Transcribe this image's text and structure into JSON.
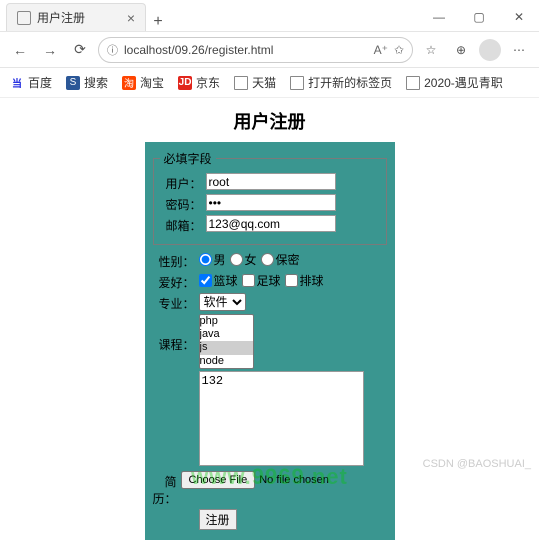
{
  "browser": {
    "tab_title": "用户注册",
    "address": "localhost/09.26/register.html",
    "new_tab": "+",
    "win_min": "—",
    "win_max": "▢",
    "win_close": "✕",
    "nav_back": "←",
    "nav_fwd": "→",
    "nav_reload": "⟳",
    "addr_info": "ⓘ",
    "addr_read": "A⁺",
    "addr_fav": "✩",
    "tool_star": "☆",
    "tool_collections": "⊕",
    "tool_menu": "⋯"
  },
  "bookmarks": {
    "baidu": "百度",
    "search": "搜索",
    "taobao": "淘宝",
    "jd": "京东",
    "tmall": "天猫",
    "newtab": "打开新的标签页",
    "year": "2020-遇见青职"
  },
  "page": {
    "title": "用户注册"
  },
  "form": {
    "fieldset_legend": "必填字段",
    "user_label": "用户：",
    "user_value": "root",
    "pwd_label": "密码：",
    "pwd_value": "•••",
    "email_label": "邮箱：",
    "email_value": "123@qq.com",
    "gender_label": "性别：",
    "gender_male": "男",
    "gender_female": "女",
    "gender_secret": "保密",
    "hobby_label": "爱好：",
    "hobby_basketball": "篮球",
    "hobby_football": "足球",
    "hobby_volleyball": "排球",
    "major_label": "专业：",
    "major_selected": "软件",
    "course_label": "课程：",
    "course_options": [
      "php",
      "java",
      "js",
      "node"
    ],
    "textarea_value": "132",
    "resume_label": "简历：",
    "submit_label": "注册"
  },
  "watermark": {
    "main": "www.9969.net",
    "side": "CSDN @BAOSHUAI_"
  }
}
